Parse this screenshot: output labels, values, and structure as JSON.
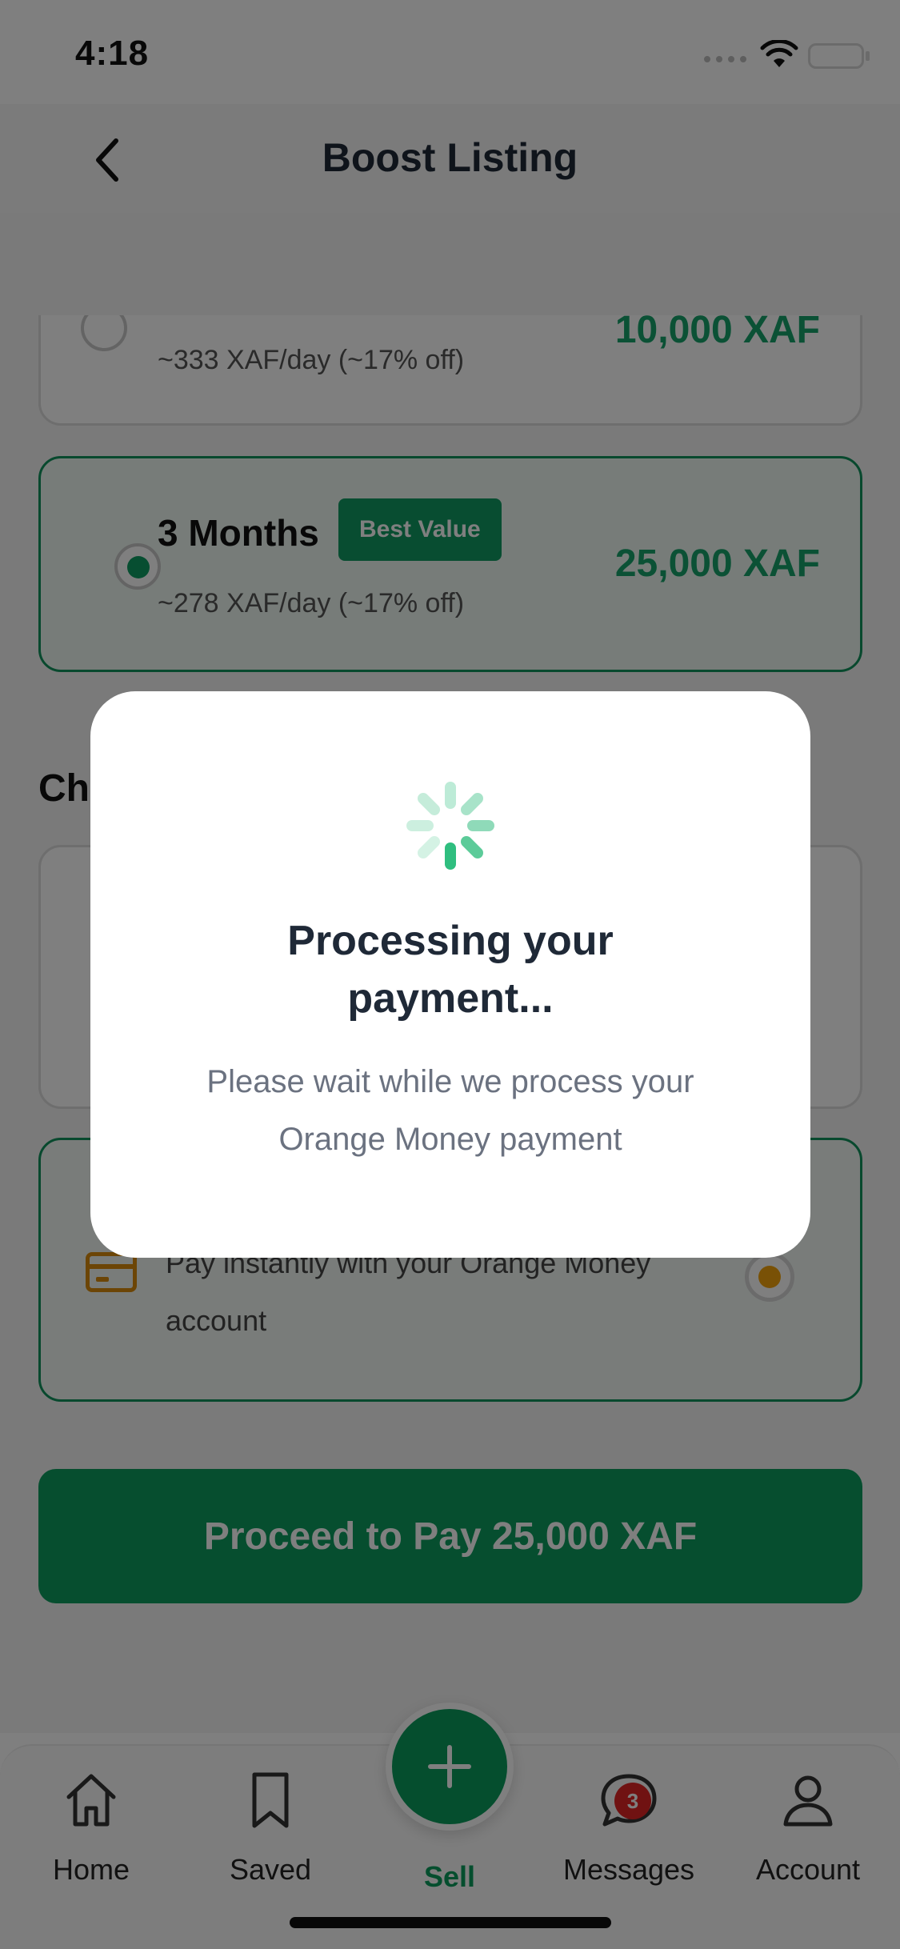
{
  "status_bar": {
    "time": "4:18"
  },
  "header": {
    "title": "Boost Listing"
  },
  "plans": [
    {
      "subtitle": "~333 XAF/day (~17% off)",
      "price": "10,000 XAF",
      "selected": false
    },
    {
      "title": "3 Months",
      "badge": "Best Value",
      "subtitle": "~278 XAF/day (~17% off)",
      "price": "25,000 XAF",
      "selected": true
    }
  ],
  "payment_section": {
    "title_partial": "Ch"
  },
  "payment_option": {
    "description": "Pay instantly with your Orange Money account"
  },
  "proceed_button": {
    "label": "Proceed to Pay 25,000 XAF"
  },
  "modal": {
    "title": "Processing your payment...",
    "message": "Please wait while we process your Orange Money payment"
  },
  "tabs": [
    {
      "label": "Home",
      "icon": "home-icon"
    },
    {
      "label": "Saved",
      "icon": "bookmark-icon"
    },
    {
      "label": "Sell",
      "icon": "plus-icon"
    },
    {
      "label": "Messages",
      "icon": "chat-icon",
      "badge": "3"
    },
    {
      "label": "Account",
      "icon": "user-icon"
    }
  ],
  "colors": {
    "accent": "#0c9c5e",
    "price": "#16a36b",
    "overlay": "rgba(0,0,0,0.5)",
    "orange": "#f3a30c",
    "badge_red": "#e02424"
  }
}
